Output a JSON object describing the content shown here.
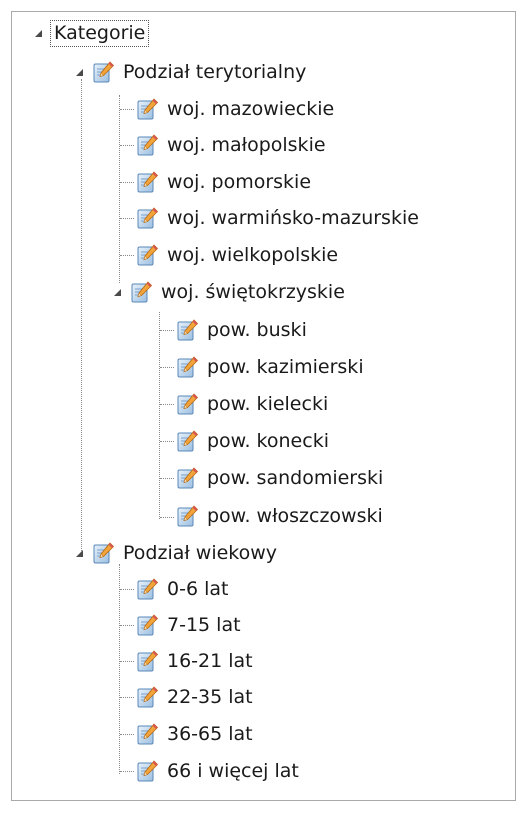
{
  "tree": {
    "root": {
      "label": "Kategorie",
      "expanded": true,
      "children": [
        {
          "label": "Podział terytorialny",
          "expanded": true,
          "icon": "document-edit-icon",
          "children": [
            {
              "label": "woj. mazowieckie",
              "icon": "document-edit-icon"
            },
            {
              "label": "woj. małopolskie",
              "icon": "document-edit-icon"
            },
            {
              "label": "woj. pomorskie",
              "icon": "document-edit-icon"
            },
            {
              "label": "woj. warmińsko-mazurskie",
              "icon": "document-edit-icon"
            },
            {
              "label": "woj. wielkopolskie",
              "icon": "document-edit-icon"
            },
            {
              "label": "woj. świętokrzyskie",
              "expanded": true,
              "icon": "document-edit-icon",
              "children": [
                {
                  "label": "pow. buski",
                  "icon": "document-edit-icon"
                },
                {
                  "label": "pow. kazimierski",
                  "icon": "document-edit-icon"
                },
                {
                  "label": "pow. kielecki",
                  "icon": "document-edit-icon"
                },
                {
                  "label": "pow. konecki",
                  "icon": "document-edit-icon"
                },
                {
                  "label": "pow. sandomierski",
                  "icon": "document-edit-icon"
                },
                {
                  "label": "pow. włoszczowski",
                  "icon": "document-edit-icon"
                }
              ]
            }
          ]
        },
        {
          "label": "Podział wiekowy",
          "expanded": true,
          "icon": "document-edit-icon",
          "children": [
            {
              "label": "0-6 lat",
              "icon": "document-edit-icon"
            },
            {
              "label": "7-15 lat",
              "icon": "document-edit-icon"
            },
            {
              "label": "16-21 lat",
              "icon": "document-edit-icon"
            },
            {
              "label": "22-35 lat",
              "icon": "document-edit-icon"
            },
            {
              "label": "36-65 lat",
              "icon": "document-edit-icon"
            },
            {
              "label": "66 i więcej lat",
              "icon": "document-edit-icon"
            }
          ]
        }
      ]
    },
    "colors": {
      "border": "#a9a9a9",
      "connector": "#8a8a8a",
      "text": "#1a1a1a",
      "expander": "#4a4a4a"
    }
  }
}
